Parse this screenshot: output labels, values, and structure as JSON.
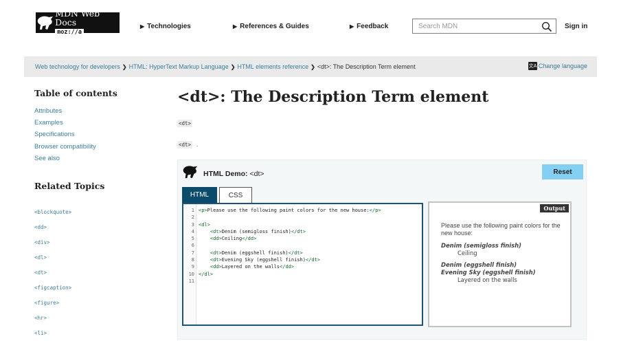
{
  "header": {
    "logo_name": "MDN Web Docs",
    "logo_badge": "moz://a",
    "nav": [
      {
        "label": "Technologies"
      },
      {
        "label": "References & Guides"
      },
      {
        "label": "Feedback"
      }
    ],
    "search_placeholder": "Search MDN",
    "sign_in": "Sign in"
  },
  "breadcrumb": {
    "items": [
      {
        "label": "Web technology for developers"
      },
      {
        "label": "HTML: HyperText Markup Language"
      },
      {
        "label": "HTML elements reference"
      },
      {
        "label": "<dt>: The Description Term element"
      }
    ],
    "change_language": "Change language"
  },
  "sidebar": {
    "toc_heading": "Table of contents",
    "toc": [
      "Attributes",
      "Examples",
      "Specifications",
      "Browser compatibility",
      "See also"
    ],
    "related_heading": "Related Topics",
    "related": [
      "<blockquote>",
      "<dd>",
      "<div>",
      "<dl>",
      "<dt>",
      "<figcaption>",
      "<figure>",
      "<hr>",
      "<li>"
    ]
  },
  "main": {
    "title": "<dt>: The Description Term element",
    "chip1": "<dt>",
    "chip2": "<dt>",
    "chip2_suffix": "."
  },
  "demo": {
    "title_prefix": "HTML Demo: ",
    "title_tag": "<dt>",
    "reset": "Reset",
    "tabs": [
      {
        "label": "HTML",
        "active": true
      },
      {
        "label": "CSS",
        "active": false
      }
    ],
    "line_numbers": "1\n2\n3\n4\n5\n6\n7\n8\n9\n10\n11",
    "output_label": "Output",
    "output": {
      "paragraph": "Please use the following paint colors for the new house:",
      "terms": [
        {
          "dt": "Denim (semigloss finish)",
          "dd": "Ceiling"
        },
        {
          "dt": "Denim (eggshell finish)"
        },
        {
          "dt": "Evening Sky (eggshell finish)",
          "dd": "Layered on the walls"
        }
      ]
    },
    "code": {
      "l1_open": "<p>",
      "l1_text": "Please use the following paint colors for the new house:",
      "l1_close": "</p>",
      "l3": "<dl>",
      "l4_open": "<dt>",
      "l4_text": "Denim (semigloss finish)",
      "l4_close": "</dt>",
      "l5_open": "<dd>",
      "l5_text": "Ceiling",
      "l5_close": "</dd>",
      "l7_open": "<dt>",
      "l7_text": "Denim (eggshell finish)",
      "l7_close": "</dt>",
      "l8_open": "<dt>",
      "l8_text": "Evening Sky (eggshell finish)",
      "l8_close": "</dt>",
      "l9_open": "<dd>",
      "l9_text": "Layered on the walls",
      "l9_close": "</dd>",
      "l10": "</dl>"
    }
  },
  "colors": {
    "link": "#3d7e9a",
    "reset_button": "#83d0f2",
    "active_tab": "#0a4b6b",
    "code_tag": "#116329"
  },
  "icons": {
    "logo": "dinosaur-icon",
    "search": "magnifier-icon",
    "language": "translate-icon",
    "demo": "dinosaur-icon"
  }
}
